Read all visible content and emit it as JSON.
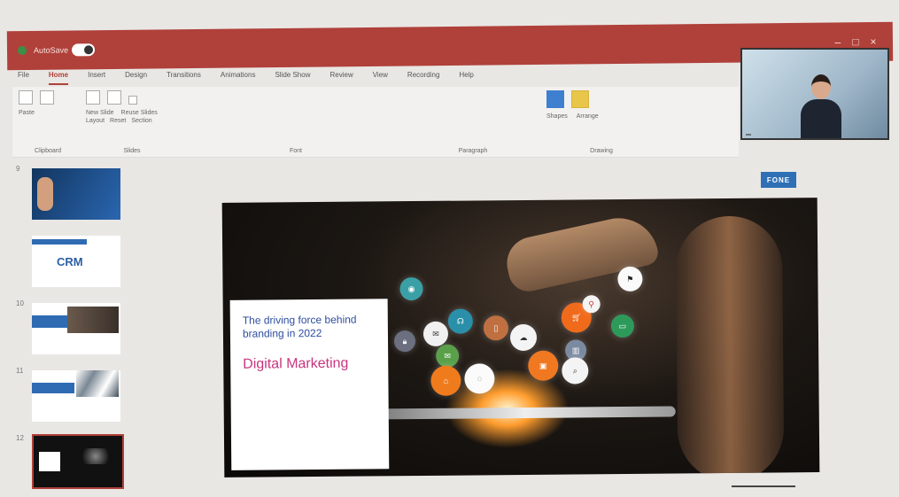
{
  "title_bar": {
    "autosave_label": "AutoSave",
    "document_title": "",
    "user_name": "",
    "colors": {
      "bar": "#b0403a"
    }
  },
  "ribbon": {
    "tabs": [
      "File",
      "Home",
      "Insert",
      "Design",
      "Transitions",
      "Animations",
      "Slide Show",
      "Review",
      "View",
      "Recording",
      "Help"
    ],
    "active_tab": "Home",
    "groups": [
      "Clipboard",
      "Slides",
      "Font",
      "Paragraph",
      "Drawing"
    ],
    "buttons": {
      "paste": "Paste",
      "new_slide": "New Slide",
      "reuse_slides": "Reuse Slides",
      "layout": "Layout",
      "reset": "Reset",
      "section": "Section",
      "shapes": "Shapes",
      "arrange": "Arrange"
    }
  },
  "webcam": {
    "name": ""
  },
  "slides": [
    {
      "number": "9",
      "kind": "image"
    },
    {
      "number": "",
      "kind": "crm",
      "text": "CRM"
    },
    {
      "number": "10",
      "kind": "image"
    },
    {
      "number": "11",
      "kind": "image"
    },
    {
      "number": "12",
      "kind": "image",
      "selected": true
    }
  ],
  "brand_badge": "FONE",
  "main_slide": {
    "tagline": "The driving force behind branding in 2022",
    "heading": "Digital Marketing",
    "colors": {
      "tagline": "#2f4fa0",
      "heading": "#c8357f"
    }
  }
}
